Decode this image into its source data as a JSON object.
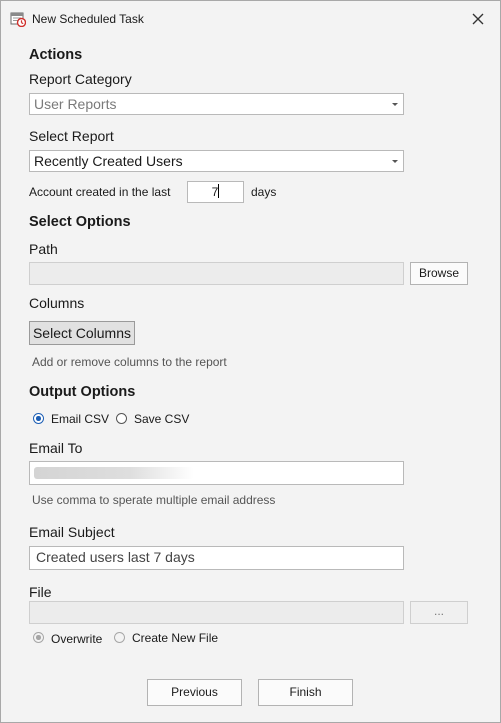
{
  "window": {
    "title": "New Scheduled Task",
    "icon": "calendar-clock-icon",
    "close_icon": "close-icon"
  },
  "actions": {
    "heading": "Actions",
    "report_category_label": "Report Category",
    "report_category_value": "User Reports",
    "select_report_label": "Select Report",
    "select_report_value": "Recently Created Users",
    "account_created_prefix": "Account created in the last",
    "account_created_days": "7",
    "account_created_suffix": "days"
  },
  "select_options": {
    "heading": "Select Options",
    "path_label": "Path",
    "path_value": "",
    "browse_label": "Browse",
    "columns_label": "Columns",
    "select_columns_label": "Select Columns",
    "columns_hint": "Add or remove columns to the report"
  },
  "output_options": {
    "heading": "Output Options",
    "email_csv_label": "Email CSV",
    "save_csv_label": "Save CSV",
    "selected_output": "Email CSV",
    "email_to_label": "Email To",
    "email_hint": "Use comma to sperate multiple email address",
    "email_subject_label": "Email Subject",
    "email_subject_value": "Created users last 7 days",
    "file_label": "File",
    "file_value": "",
    "file_browse_label": "...",
    "overwrite_label": "Overwrite",
    "create_new_file_label": "Create New File",
    "selected_file_mode": "Overwrite"
  },
  "footer": {
    "previous_label": "Previous",
    "finish_label": "Finish"
  },
  "colors": {
    "accent": "#1d5fb5",
    "window_bg": "#f3f3f3"
  }
}
